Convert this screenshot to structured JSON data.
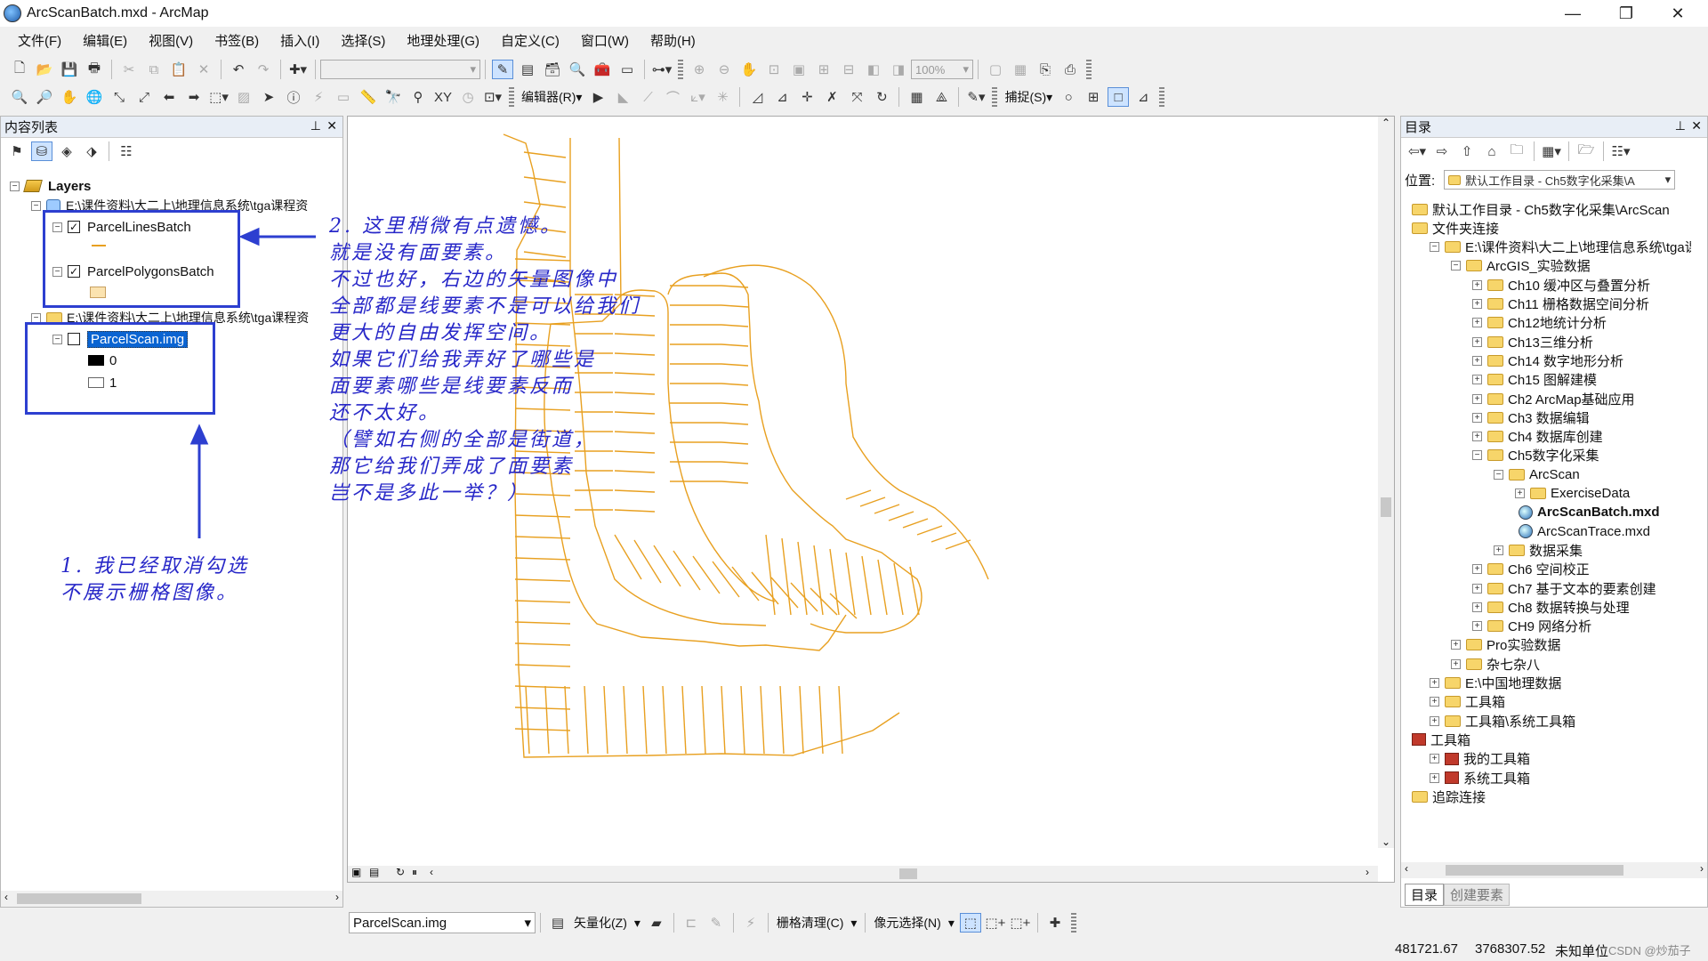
{
  "window": {
    "title": "ArcScanBatch.mxd - ArcMap",
    "minimize": "—",
    "restore": "❐",
    "close": "✕"
  },
  "menu": [
    "文件(F)",
    "编辑(E)",
    "视图(V)",
    "书签(B)",
    "插入(I)",
    "选择(S)",
    "地理处理(G)",
    "自定义(C)",
    "窗口(W)",
    "帮助(H)"
  ],
  "toolbar": {
    "zoom_level": "100%",
    "editor_label": "编辑器(R)▾",
    "snapping_label": "捕捉(S)▾",
    "vectorize_label": "矢量化(Z)",
    "raster_cleanup_label": "栅格清理(C)",
    "cell_select_label": "像元选择(N)",
    "raster_layer_value": "ParcelScan.img"
  },
  "toc": {
    "title": "内容列表",
    "pin": "📌",
    "close": "✕",
    "root": "Layers",
    "groups": [
      {
        "path": "E:\\课件资料\\大二上\\地理信息系统\\tga课程资",
        "layers": [
          {
            "name": "ParcelLinesBatch",
            "checked": true
          },
          {
            "name": "ParcelPolygonsBatch",
            "checked": true
          }
        ]
      },
      {
        "path": "E:\\课件资料\\大二上\\地理信息系统\\tga课程资",
        "layers": [
          {
            "name": "ParcelScan.img",
            "checked": false,
            "values": [
              "0",
              "1"
            ]
          }
        ]
      }
    ]
  },
  "annotations": {
    "note2": [
      "2. 这里稍微有点遗憾。",
      "就是没有面要素。",
      "不过也好，右边的矢量图像中",
      "全部都是线要素不是可以给我们",
      "更大的自由发挥空间。",
      "如果它们给我弄好了哪些是",
      "面要素哪些是线要素反而",
      "还不太好。",
      "（譬如右侧的全部是街道，",
      "那它给我们弄成了面要素",
      "岂不是多此一举？）"
    ],
    "note1": [
      "1. 我已经取消勾选",
      "不展示栅格图像。"
    ]
  },
  "catalog": {
    "title": "目录",
    "location_label": "位置:",
    "location_value": "默认工作目录 - Ch5数字化采集\\A",
    "items": [
      {
        "label": "默认工作目录 - Ch5数字化采集\\ArcScan",
        "level": 0,
        "icon": "folder",
        "exp": ""
      },
      {
        "label": "文件夹连接",
        "level": 0,
        "icon": "folder",
        "exp": ""
      },
      {
        "label": "E:\\课件资料\\大二上\\地理信息系统\\tga课",
        "level": 1,
        "icon": "folder",
        "exp": "−"
      },
      {
        "label": "ArcGIS_实验数据",
        "level": 2,
        "icon": "folder",
        "exp": "−"
      },
      {
        "label": "Ch10 缓冲区与叠置分析",
        "level": 3,
        "icon": "folder",
        "exp": "+"
      },
      {
        "label": "Ch11 栅格数据空间分析",
        "level": 3,
        "icon": "folder",
        "exp": "+"
      },
      {
        "label": "Ch12地统计分析",
        "level": 3,
        "icon": "folder",
        "exp": "+"
      },
      {
        "label": "Ch13三维分析",
        "level": 3,
        "icon": "folder",
        "exp": "+"
      },
      {
        "label": "Ch14 数字地形分析",
        "level": 3,
        "icon": "folder",
        "exp": "+"
      },
      {
        "label": "Ch15 图解建模",
        "level": 3,
        "icon": "folder",
        "exp": "+"
      },
      {
        "label": "Ch2 ArcMap基础应用",
        "level": 3,
        "icon": "folder",
        "exp": "+"
      },
      {
        "label": "Ch3 数据编辑",
        "level": 3,
        "icon": "folder",
        "exp": "+"
      },
      {
        "label": "Ch4 数据库创建",
        "level": 3,
        "icon": "folder",
        "exp": "+"
      },
      {
        "label": "Ch5数字化采集",
        "level": 3,
        "icon": "folder",
        "exp": "−"
      },
      {
        "label": "ArcScan",
        "level": 4,
        "icon": "folder",
        "exp": "−"
      },
      {
        "label": "ExerciseData",
        "level": 5,
        "icon": "folder",
        "exp": "+"
      },
      {
        "label": "ArcScanBatch.mxd",
        "level": 5,
        "icon": "mxd",
        "exp": "",
        "bold": true
      },
      {
        "label": "ArcScanTrace.mxd",
        "level": 5,
        "icon": "mxd",
        "exp": ""
      },
      {
        "label": "数据采集",
        "level": 4,
        "icon": "folder",
        "exp": "+"
      },
      {
        "label": "Ch6 空间校正",
        "level": 3,
        "icon": "folder",
        "exp": "+"
      },
      {
        "label": "Ch7 基于文本的要素创建",
        "level": 3,
        "icon": "folder",
        "exp": "+"
      },
      {
        "label": "Ch8 数据转换与处理",
        "level": 3,
        "icon": "folder",
        "exp": "+"
      },
      {
        "label": "CH9 网络分析",
        "level": 3,
        "icon": "folder",
        "exp": "+"
      },
      {
        "label": "Pro实验数据",
        "level": 2,
        "icon": "folder",
        "exp": "+"
      },
      {
        "label": "杂七杂八",
        "level": 2,
        "icon": "folder",
        "exp": "+"
      },
      {
        "label": "E:\\中国地理数据",
        "level": 1,
        "icon": "folder",
        "exp": "+"
      },
      {
        "label": "工具箱",
        "level": 1,
        "icon": "folder",
        "exp": "+"
      },
      {
        "label": "工具箱\\系统工具箱",
        "level": 1,
        "icon": "folder",
        "exp": "+"
      },
      {
        "label": "工具箱",
        "level": 0,
        "icon": "toolbox",
        "exp": ""
      },
      {
        "label": "我的工具箱",
        "level": 1,
        "icon": "toolbox",
        "exp": "+"
      },
      {
        "label": "系统工具箱",
        "level": 1,
        "icon": "toolbox",
        "exp": "+"
      },
      {
        "label": "追踪连接",
        "level": 0,
        "icon": "folder",
        "exp": ""
      }
    ],
    "tabs": [
      "目录",
      "创建要素"
    ]
  },
  "status": {
    "x": "481721.67",
    "y": "3768307.52",
    "units": "未知单位",
    "watermark": "CSDN @炒茄子"
  },
  "colors": {
    "parcel_line": "#e8a020",
    "annotation": "#2727c8",
    "selection": "#0a64d2"
  }
}
